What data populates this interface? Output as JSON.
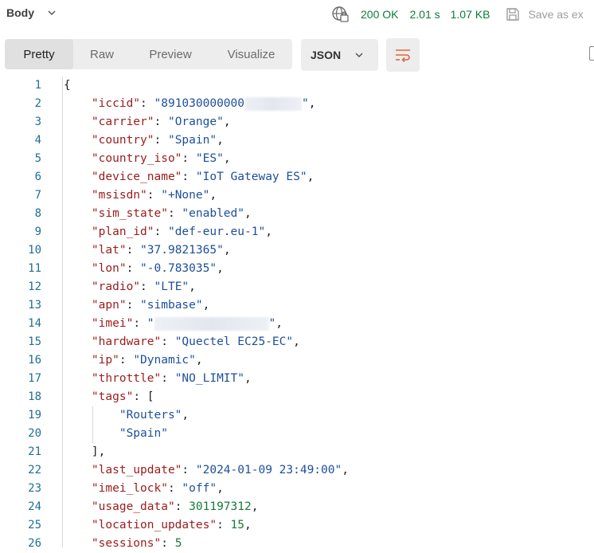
{
  "toolbar": {
    "body_label": "Body",
    "status": "200 OK",
    "time": "2.01 s",
    "size": "1.07 KB",
    "save_label": "Save as ex"
  },
  "tabs": [
    {
      "label": "Pretty",
      "active": true
    },
    {
      "label": "Raw",
      "active": false
    },
    {
      "label": "Preview",
      "active": false
    },
    {
      "label": "Visualize",
      "active": false
    }
  ],
  "format": "JSON",
  "colors": {
    "key": "#9b1c1c",
    "string": "#1d4f9c",
    "number": "#177a3b",
    "status": "#0f7b3a"
  },
  "code_lines": [
    {
      "n": "1"
    },
    {
      "n": "2",
      "key": "iccid",
      "val": "891030000000",
      "redacted": true
    },
    {
      "n": "3",
      "key": "carrier",
      "val": "Orange"
    },
    {
      "n": "4",
      "key": "country",
      "val": "Spain"
    },
    {
      "n": "5",
      "key": "country_iso",
      "val": "ES"
    },
    {
      "n": "6",
      "key": "device_name",
      "val": "IoT Gateway ES"
    },
    {
      "n": "7",
      "key": "msisdn",
      "val": "+None"
    },
    {
      "n": "8",
      "key": "sim_state",
      "val": "enabled"
    },
    {
      "n": "9",
      "key": "plan_id",
      "val": "def-eur.eu-1"
    },
    {
      "n": "10",
      "key": "lat",
      "val": "37.9821365"
    },
    {
      "n": "11",
      "key": "lon",
      "val": "-0.783035"
    },
    {
      "n": "12",
      "key": "radio",
      "val": "LTE"
    },
    {
      "n": "13",
      "key": "apn",
      "val": "simbase"
    },
    {
      "n": "14",
      "key": "imei",
      "val": "",
      "redacted": true
    },
    {
      "n": "15",
      "key": "hardware",
      "val": "Quectel EC25-EC"
    },
    {
      "n": "16",
      "key": "ip",
      "val": "Dynamic"
    },
    {
      "n": "17",
      "key": "throttle",
      "val": "NO_LIMIT"
    },
    {
      "n": "18",
      "key": "tags"
    },
    {
      "n": "19",
      "item": "Routers"
    },
    {
      "n": "20",
      "item": "Spain"
    },
    {
      "n": "21"
    },
    {
      "n": "22",
      "key": "last_update",
      "val": "2024-01-09 23:49:00"
    },
    {
      "n": "23",
      "key": "imei_lock",
      "val": "off"
    },
    {
      "n": "24",
      "key": "usage_data",
      "num": "301197312"
    },
    {
      "n": "25",
      "key": "location_updates",
      "num": "15"
    },
    {
      "n": "26",
      "key": "sessions",
      "num": "5"
    }
  ]
}
